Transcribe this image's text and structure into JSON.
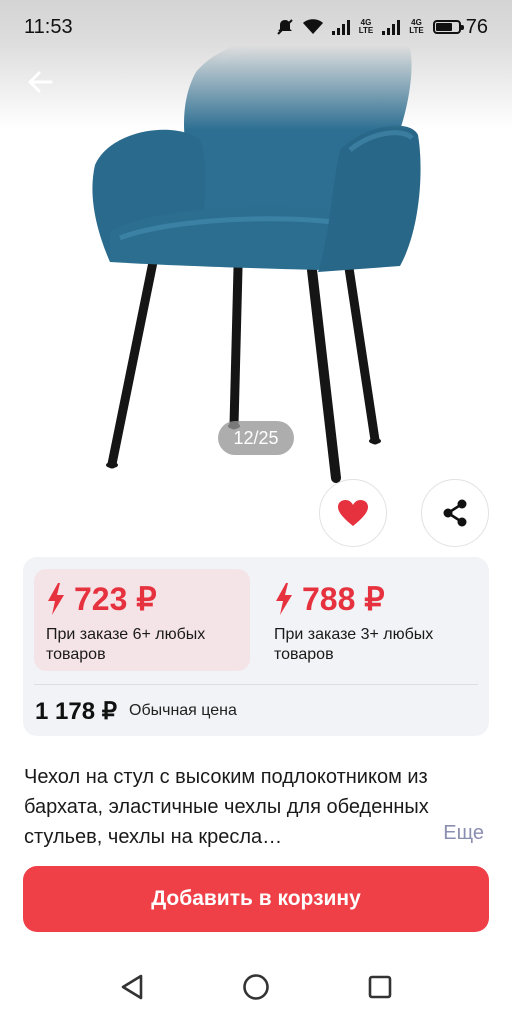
{
  "status_bar": {
    "time": "11:53",
    "network_1": "4G",
    "network_2": "4G",
    "battery": "76"
  },
  "header": {
    "back_icon": "arrow-left-icon"
  },
  "gallery": {
    "counter": "12/25",
    "product_color": "#2a6c8f"
  },
  "actions": {
    "favorite_icon": "heart-icon",
    "share_icon": "share-icon"
  },
  "prices": {
    "tiers": [
      {
        "price": "723 ₽",
        "note": "При заказе 6+ любых товаров",
        "selected": true
      },
      {
        "price": "788 ₽",
        "note": "При заказе 3+ любых товаров",
        "selected": false
      }
    ],
    "regular_price": "1 178 ₽",
    "regular_label": "Обычная цена",
    "accent": "#e6323e"
  },
  "description": {
    "text": "Чехол на стул с высоким подлокотником из бархата, эластичные чехлы для обеденных стульев, чехлы на кресла…",
    "more": "Еще"
  },
  "cta": {
    "label": "Добавить в корзину",
    "color": "#ef3f47"
  },
  "navbar": {
    "back_icon": "triangle-back-icon",
    "home_icon": "circle-home-icon",
    "recents_icon": "square-recents-icon"
  }
}
